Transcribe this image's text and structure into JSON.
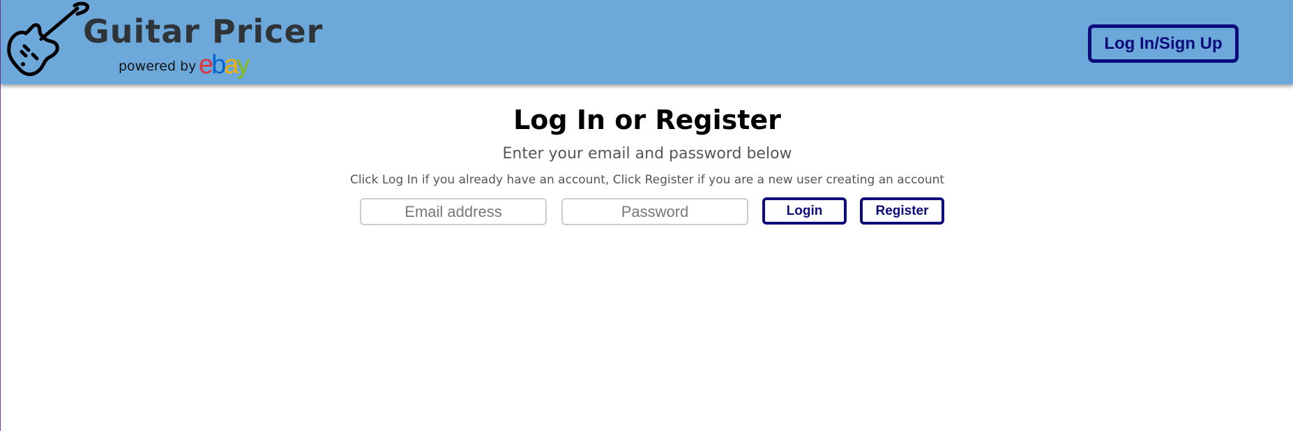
{
  "header": {
    "brand_title": "Guitar Pricer",
    "powered_by": "powered by",
    "ebay_logo": {
      "e": "e",
      "b": "b",
      "a": "a",
      "y": "y"
    },
    "auth_button_label": "Log In/Sign Up",
    "icons": {
      "logo": "electric-guitar-icon"
    }
  },
  "main": {
    "title": "Log In or Register",
    "subtitle": "Enter your email and password below",
    "instructions": "Click Log In if you already have an account, Click Register if you are a new user creating an account",
    "email_placeholder": "Email address",
    "email_value": "",
    "password_placeholder": "Password",
    "password_value": "",
    "login_label": "Login",
    "register_label": "Register"
  },
  "colors": {
    "header_bg": "#6ca8da",
    "accent": "#0d0a7a",
    "brand_text": "#2f3438",
    "ebay_red": "#e53238",
    "ebay_blue": "#0064d2",
    "ebay_yellow": "#f5af02",
    "ebay_green": "#86b817"
  }
}
